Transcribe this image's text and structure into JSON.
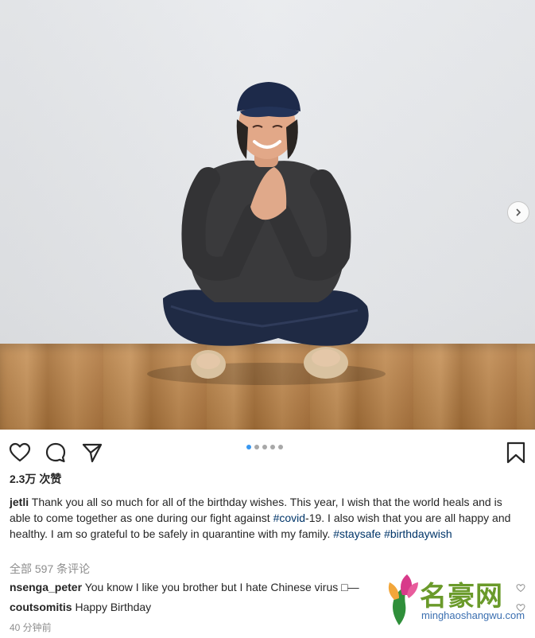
{
  "post": {
    "likes": "2.3万 次赞",
    "username": "jetli",
    "caption_text": "Thank you all so much for all of the birthday wishes. This year, I wish that the world heals and is able to come together as one during our fight against ",
    "caption_tag1": "#covid",
    "caption_mid": "-19. I also wish that you are all happy and healthy. I am so grateful to be safely in quarantine with my family. ",
    "caption_tag2": "#staysafe",
    "caption_tag3": "#birthdaywish",
    "view_all_comments": "全部 597 条评论",
    "comments": [
      {
        "user": "nsenga_peter",
        "text": "You know I like you brother but I hate Chinese virus □—"
      },
      {
        "user": "coutsomitis",
        "text": "Happy Birthday"
      }
    ],
    "timestamp": "40 分钟前"
  },
  "carousel": {
    "count": 5,
    "active": 0
  },
  "watermark": {
    "title": "名豪网",
    "subtitle": "minghaoshangwu.com"
  },
  "icons": [
    "heart-icon",
    "comment-icon",
    "share-icon",
    "bookmark-icon",
    "chevron-right-icon"
  ],
  "colors": {
    "tag": "#003569",
    "active_dot": "#3897f0",
    "muted": "#8e8e8e"
  }
}
